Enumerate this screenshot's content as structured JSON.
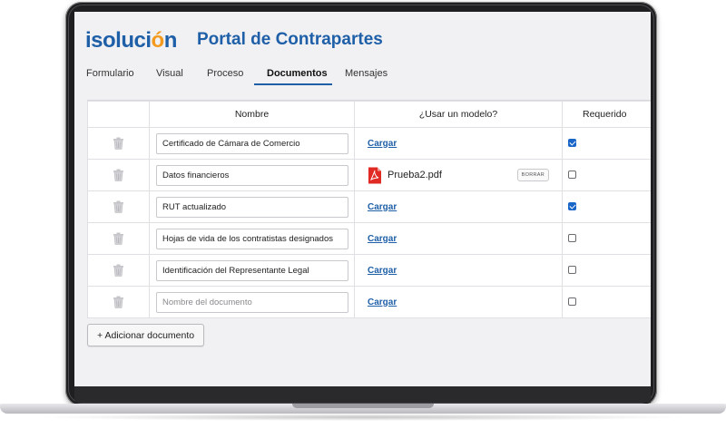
{
  "brand": {
    "logo_text": "isolución",
    "portal_title": "Portal de Contrapartes",
    "primary_color": "#1e5fa8",
    "accent_color": "#f39a1e"
  },
  "tabs": [
    {
      "label": "Formulario",
      "active": false
    },
    {
      "label": "Visual",
      "active": false
    },
    {
      "label": "Proceso",
      "active": false
    },
    {
      "label": "Documentos",
      "active": true
    },
    {
      "label": "Mensajes",
      "active": false
    }
  ],
  "table": {
    "headers": {
      "nombre": "Nombre",
      "modelo": "¿Usar un modelo?",
      "requerido": "Requerido"
    },
    "rows": [
      {
        "name": "Certificado de Cámara de Comercio",
        "model": "Cargar",
        "required": true
      },
      {
        "name": "Datos financieros",
        "file": "Prueba2.pdf",
        "delete_label": "BORRAR",
        "required": false
      },
      {
        "name": "RUT actualizado",
        "model": "Cargar",
        "required": true
      },
      {
        "name": "Hojas de vida de los contratistas designados",
        "model": "Cargar",
        "required": false
      },
      {
        "name": "Identificación del Representante Legal",
        "model": "Cargar",
        "required": false
      },
      {
        "name": "",
        "placeholder": "Nombre del documento",
        "model": "Cargar",
        "required": false
      }
    ]
  },
  "actions": {
    "add_document": "+ Adicionar documento"
  },
  "icons": {
    "trash": "trash-icon",
    "pdf": "pdf-icon",
    "checkbox_checked_color": "#1a65c8"
  }
}
